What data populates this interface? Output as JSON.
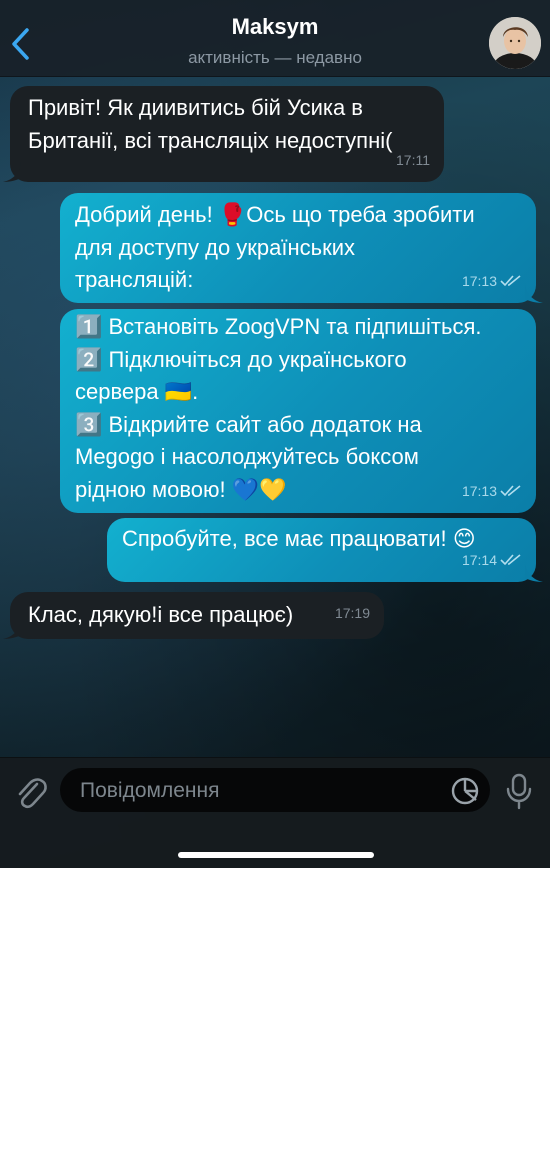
{
  "header": {
    "title": "Maksym",
    "status": "активність — недавно"
  },
  "messages": [
    {
      "direction": "in",
      "text": "Привіт! Як диивитись бій Усика в\nБританії, всі трансляціх недоступні(",
      "time": "17:11"
    },
    {
      "direction": "out",
      "text": "Добрий день! 🥊Ось що треба зробити\nдля доступу до українських\nтрансляцій:",
      "time": "17:13",
      "read": true
    },
    {
      "direction": "out",
      "text": "1️⃣ Встановіть ZoogVPN та підпишіться.\n2️⃣ Підключіться до українського\nсервера 🇺🇦.\n3️⃣ Відкрийте сайт або додаток на\nMegogo і насолоджуйтесь боксом\nрідною мовою! 💙💛",
      "time": "17:13",
      "read": true
    },
    {
      "direction": "out",
      "text": "Спробуйте, все має працювати! 😊",
      "time": "17:14",
      "read": true
    },
    {
      "direction": "in",
      "text": "Клас, дякую!і все працює)",
      "time": "17:19"
    }
  ],
  "input": {
    "placeholder": "Повідомлення"
  },
  "colors": {
    "incoming_bubble": "#1b2024",
    "outgoing_bubble": "#12a6c9",
    "accent": "#3ba7f0"
  }
}
